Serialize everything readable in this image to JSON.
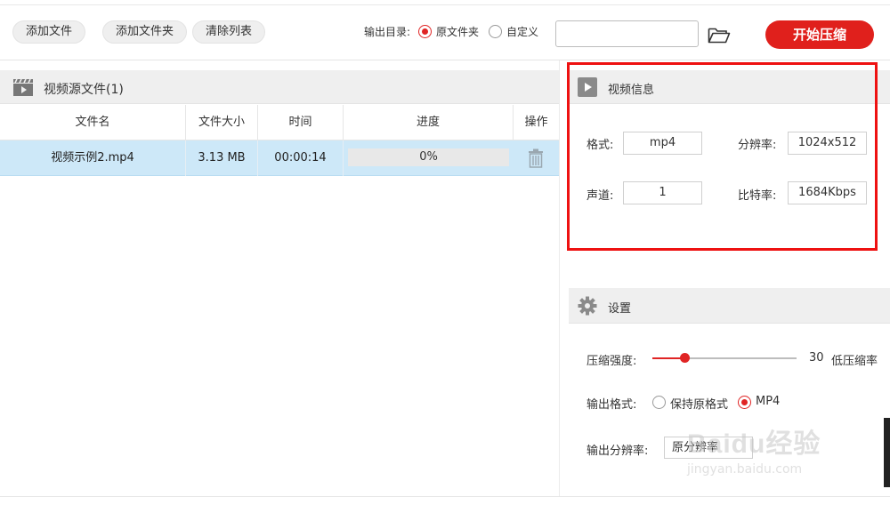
{
  "toolbar": {
    "add_file": "添加文件",
    "add_folder": "添加文件夹",
    "clear_list": "清除列表",
    "output_label": "输出目录:",
    "opt_source": "原文件夹",
    "opt_custom": "自定义",
    "selected_output": "原文件夹",
    "path_value": "",
    "start": "开始压缩"
  },
  "source": {
    "title": "视频源文件(1)",
    "columns": [
      "文件名",
      "文件大小",
      "时间",
      "进度",
      "操作"
    ],
    "rows": [
      {
        "name": "视频示例2.mp4",
        "size": "3.13 MB",
        "duration": "00:00:14",
        "progress_text": "0%",
        "progress": 0
      }
    ]
  },
  "info": {
    "title": "视频信息",
    "format_label": "格式:",
    "format": "mp4",
    "resolution_label": "分辨率:",
    "resolution": "1024x512",
    "channel_label": "声道:",
    "channel": "1",
    "bitrate_label": "比特率:",
    "bitrate": "1684Kbps"
  },
  "settings": {
    "title": "设置",
    "strength_label": "压缩强度:",
    "strength_value": "30",
    "strength_level": 0.22,
    "strength_desc": "低压缩率",
    "format_label": "输出格式:",
    "opt_keep": "保持原格式",
    "opt_mp4": "MP4",
    "selected_format": "MP4",
    "res_label": "输出分辨率:",
    "res_value": "原分辨率"
  },
  "watermark": {
    "brand": "Baidu经验",
    "url": "jingyan.baidu.com"
  },
  "colors": {
    "accent": "#e02424",
    "selected_row": "#cde8f8",
    "highlight_box": "#ee1111"
  }
}
